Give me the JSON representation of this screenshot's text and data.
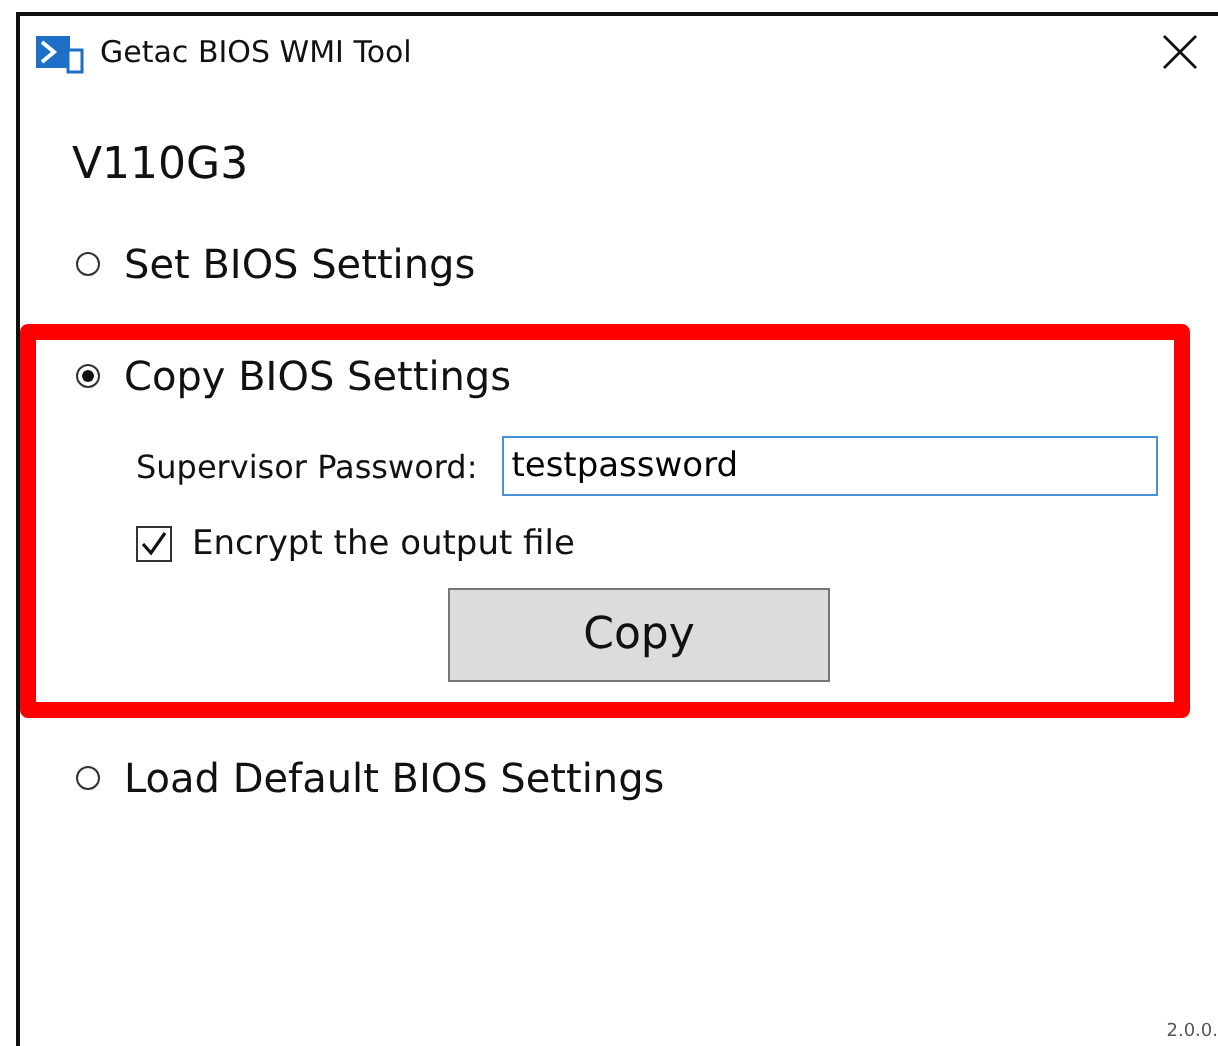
{
  "window": {
    "title": "Getac BIOS WMI Tool"
  },
  "model": "V110G3",
  "options": [
    {
      "label": "Set BIOS Settings",
      "selected": false,
      "highlighted": false
    },
    {
      "label": "Copy BIOS Settings",
      "selected": true,
      "highlighted": true,
      "password": {
        "label": "Supervisor Password:",
        "value": "testpassword"
      },
      "encrypt": {
        "label": "Encrypt the output file",
        "checked": true
      },
      "button": "Copy"
    },
    {
      "label": "Load Default BIOS Settings",
      "selected": false,
      "highlighted": false
    }
  ],
  "version": "2.0.0."
}
